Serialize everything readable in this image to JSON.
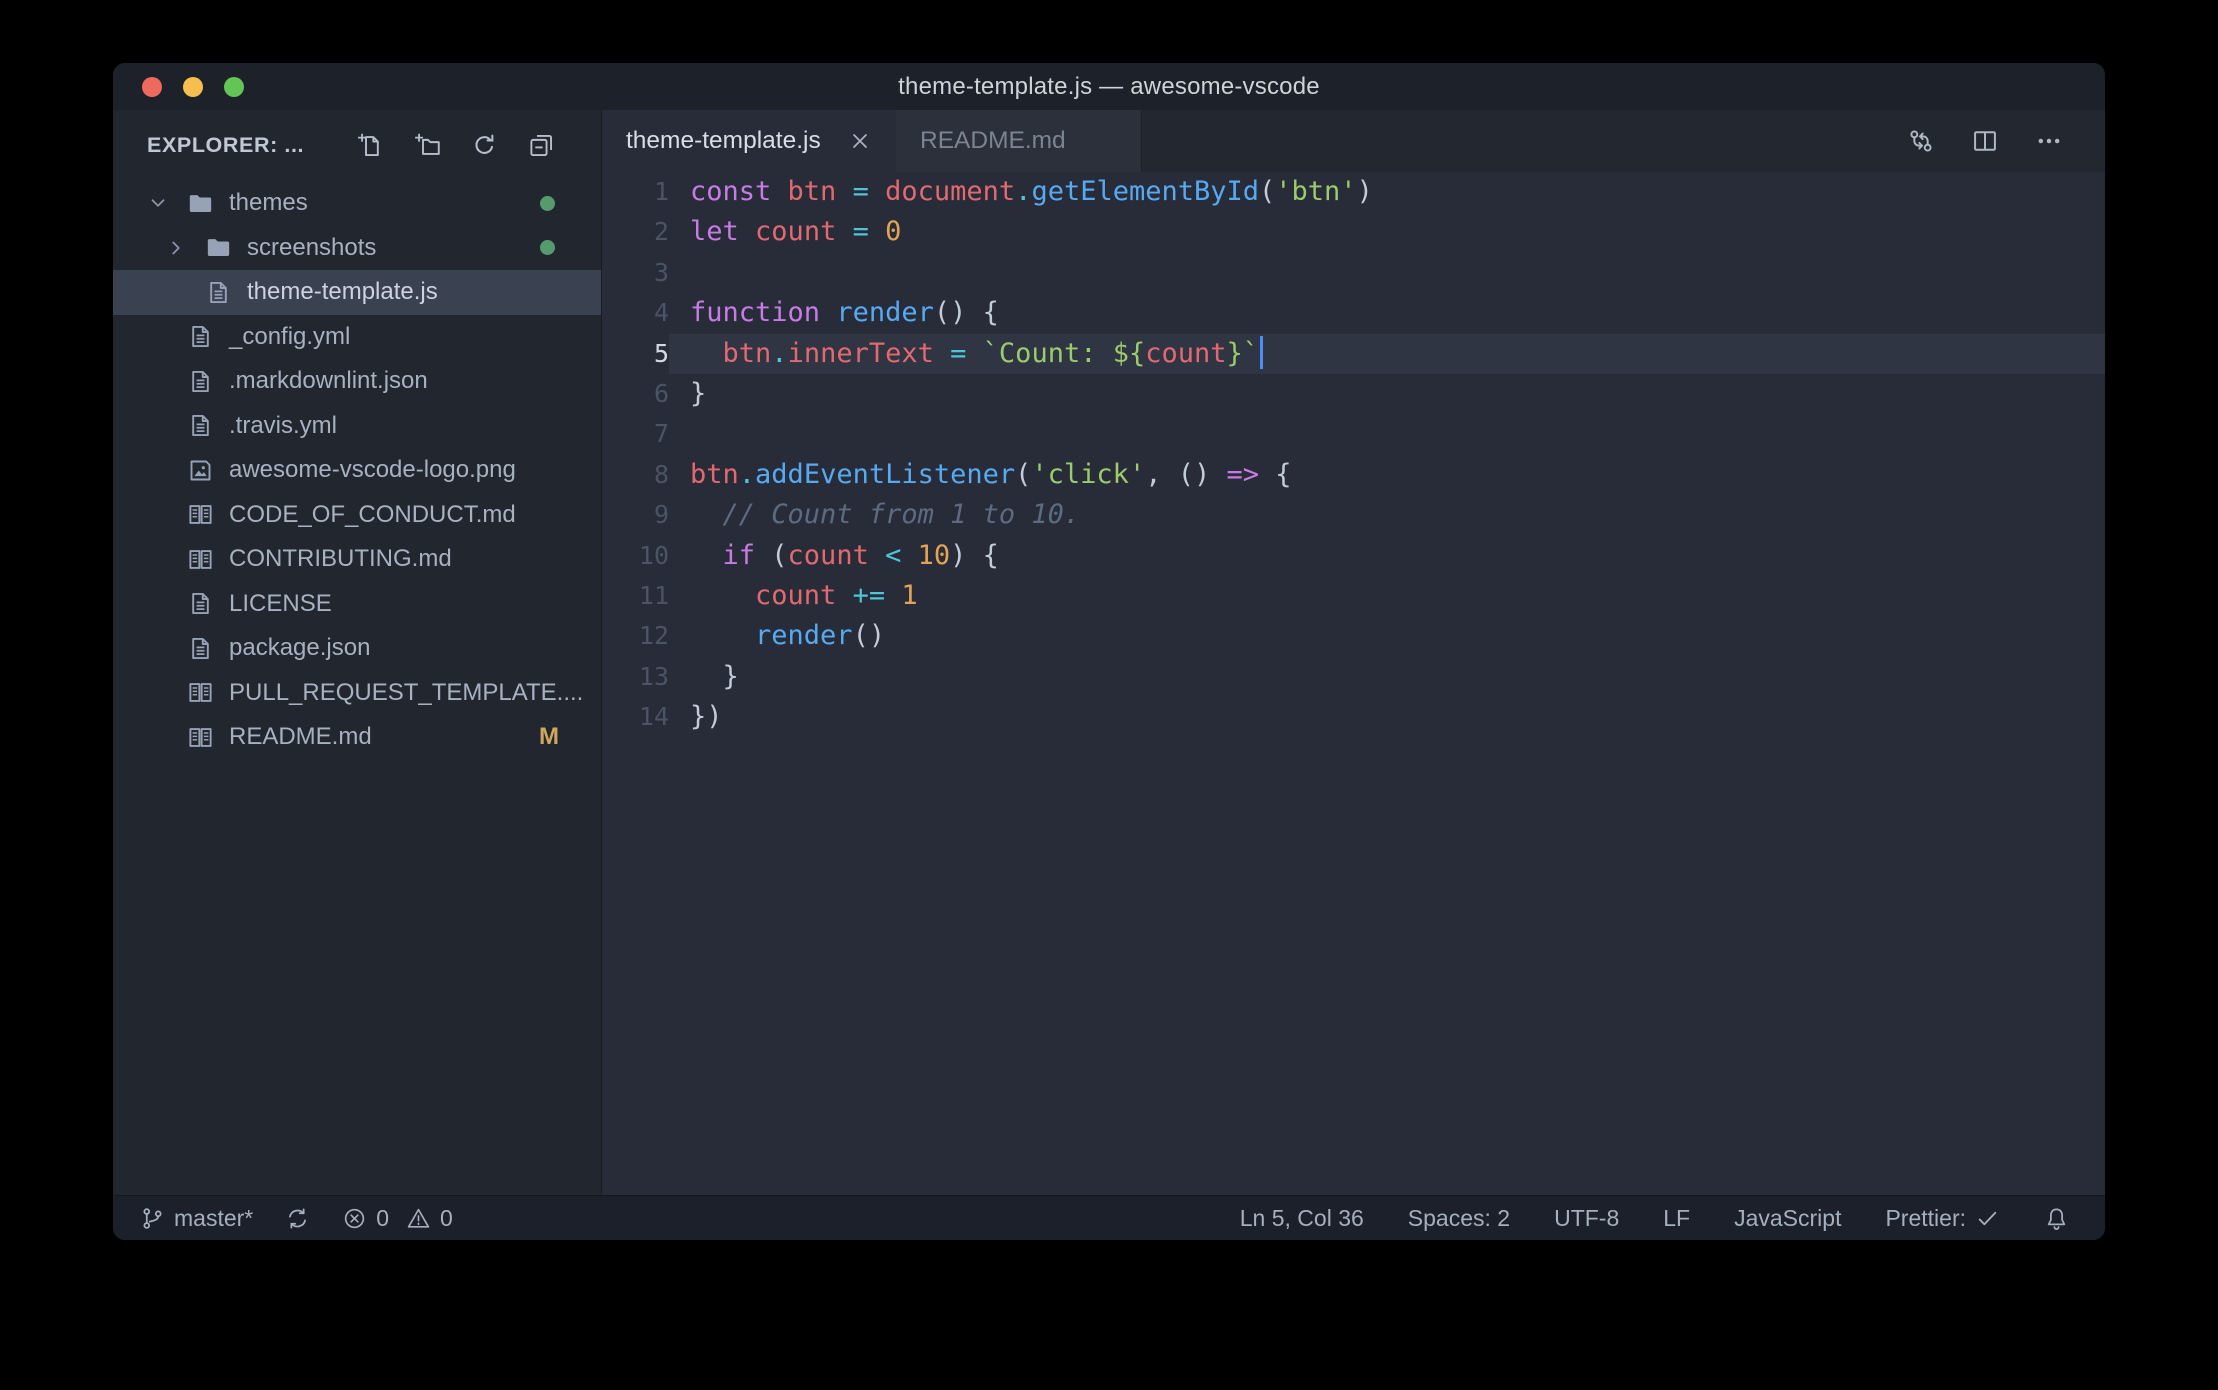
{
  "window": {
    "title": "theme-template.js — awesome-vscode"
  },
  "explorer": {
    "header": "EXPLORER: ...",
    "action_icons": [
      "new-file-icon",
      "new-folder-icon",
      "refresh-icon",
      "collapse-all-icon"
    ],
    "tree": [
      {
        "label": "themes",
        "type": "folder",
        "expanded": true,
        "indent": 0,
        "badge": "dot"
      },
      {
        "label": "screenshots",
        "type": "folder",
        "expanded": false,
        "indent": 1,
        "badge": "dot"
      },
      {
        "label": "theme-template.js",
        "type": "file",
        "indent": 1,
        "selected": true
      },
      {
        "label": "_config.yml",
        "type": "file",
        "indent": 0
      },
      {
        "label": ".markdownlint.json",
        "type": "file",
        "indent": 0
      },
      {
        "label": ".travis.yml",
        "type": "file",
        "indent": 0
      },
      {
        "label": "awesome-vscode-logo.png",
        "type": "image",
        "indent": 0
      },
      {
        "label": "CODE_OF_CONDUCT.md",
        "type": "markdown",
        "indent": 0
      },
      {
        "label": "CONTRIBUTING.md",
        "type": "markdown",
        "indent": 0
      },
      {
        "label": "LICENSE",
        "type": "file",
        "indent": 0
      },
      {
        "label": "package.json",
        "type": "file",
        "indent": 0
      },
      {
        "label": "PULL_REQUEST_TEMPLATE....",
        "type": "markdown",
        "indent": 0
      },
      {
        "label": "README.md",
        "type": "markdown",
        "indent": 0,
        "badge": "M"
      }
    ]
  },
  "tabs": [
    {
      "label": "theme-template.js",
      "active": true,
      "closable": true
    },
    {
      "label": "README.md",
      "active": false
    }
  ],
  "tab_action_icons": [
    "open-changes-icon",
    "split-editor-icon",
    "more-actions-icon"
  ],
  "editor": {
    "active_line": 5,
    "lines": [
      {
        "n": 1,
        "segs": [
          [
            "kw",
            "const"
          ],
          [
            "def",
            " "
          ],
          [
            "var",
            "btn"
          ],
          [
            "def",
            " "
          ],
          [
            "op",
            "="
          ],
          [
            "def",
            " "
          ],
          [
            "var",
            "document"
          ],
          [
            "op",
            "."
          ],
          [
            "fn",
            "getElementById"
          ],
          [
            "pun",
            "("
          ],
          [
            "str",
            "'btn'"
          ],
          [
            "pun",
            ")"
          ]
        ]
      },
      {
        "n": 2,
        "segs": [
          [
            "kw",
            "let"
          ],
          [
            "def",
            " "
          ],
          [
            "var",
            "count"
          ],
          [
            "def",
            " "
          ],
          [
            "op",
            "="
          ],
          [
            "def",
            " "
          ],
          [
            "num",
            "0"
          ]
        ]
      },
      {
        "n": 3,
        "segs": []
      },
      {
        "n": 4,
        "segs": [
          [
            "kw",
            "function"
          ],
          [
            "def",
            " "
          ],
          [
            "fn",
            "render"
          ],
          [
            "pun",
            "() {"
          ]
        ]
      },
      {
        "n": 5,
        "active": true,
        "cursor": true,
        "segs": [
          [
            "def",
            "  "
          ],
          [
            "var",
            "btn"
          ],
          [
            "op",
            "."
          ],
          [
            "var",
            "innerText"
          ],
          [
            "def",
            " "
          ],
          [
            "op",
            "="
          ],
          [
            "def",
            " "
          ],
          [
            "str",
            "`Count: ${"
          ],
          [
            "var",
            "count"
          ],
          [
            "str",
            "}`"
          ]
        ]
      },
      {
        "n": 6,
        "segs": [
          [
            "pun",
            "}"
          ]
        ]
      },
      {
        "n": 7,
        "segs": []
      },
      {
        "n": 8,
        "segs": [
          [
            "var",
            "btn"
          ],
          [
            "op",
            "."
          ],
          [
            "fn",
            "addEventListener"
          ],
          [
            "pun",
            "("
          ],
          [
            "str",
            "'click'"
          ],
          [
            "pun",
            ", () "
          ],
          [
            "kw",
            "=>"
          ],
          [
            "pun",
            " {"
          ]
        ]
      },
      {
        "n": 9,
        "segs": [
          [
            "com",
            "  // Count from 1 to 10."
          ]
        ]
      },
      {
        "n": 10,
        "segs": [
          [
            "def",
            "  "
          ],
          [
            "kw",
            "if"
          ],
          [
            "pun",
            " ("
          ],
          [
            "var",
            "count"
          ],
          [
            "def",
            " "
          ],
          [
            "op",
            "<"
          ],
          [
            "def",
            " "
          ],
          [
            "num",
            "10"
          ],
          [
            "pun",
            ") {"
          ]
        ]
      },
      {
        "n": 11,
        "segs": [
          [
            "def",
            "    "
          ],
          [
            "var",
            "count"
          ],
          [
            "def",
            " "
          ],
          [
            "op",
            "+="
          ],
          [
            "def",
            " "
          ],
          [
            "num",
            "1"
          ]
        ]
      },
      {
        "n": 12,
        "segs": [
          [
            "def",
            "    "
          ],
          [
            "fn",
            "render"
          ],
          [
            "pun",
            "()"
          ]
        ]
      },
      {
        "n": 13,
        "segs": [
          [
            "def",
            "  "
          ],
          [
            "pun",
            "}"
          ]
        ]
      },
      {
        "n": 14,
        "segs": [
          [
            "pun",
            "})"
          ]
        ]
      }
    ]
  },
  "status_bar": {
    "branch": "master*",
    "errors": "0",
    "warnings": "0",
    "cursor_position": "Ln 5, Col 36",
    "indentation": "Spaces: 2",
    "encoding": "UTF-8",
    "eol": "LF",
    "language": "JavaScript",
    "formatter": "Prettier:",
    "icons": [
      "git-branch-icon",
      "sync-icon",
      "error-icon",
      "warning-icon",
      "check-icon",
      "bell-icon"
    ]
  },
  "colors": {
    "keyword_purple": "#c87be4",
    "variable_red": "#e26970",
    "function_blue": "#57aaf2",
    "string_green": "#9bcb6d",
    "operator_cyan": "#50c5d8",
    "number_orange": "#e3a356",
    "comment_gray": "#5d6a80",
    "git_decoration_green": "#569b6e",
    "modified_badge_gold": "#cfa75e",
    "traffic_red": "#ee6a5e",
    "traffic_yellow": "#f5bf4f",
    "traffic_green": "#62c554",
    "cursor_blue": "#4e8df6"
  }
}
